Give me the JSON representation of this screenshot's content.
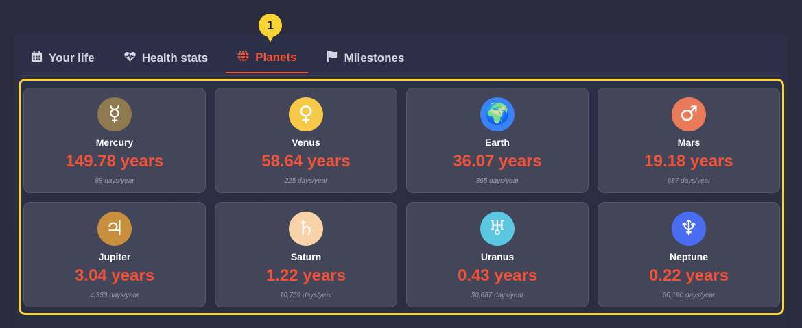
{
  "tour": {
    "step": "1",
    "color": "#f9d334"
  },
  "tabs": [
    {
      "label": "Your life",
      "icon": "calendar-icon",
      "active": false
    },
    {
      "label": "Health stats",
      "icon": "heartbeat-icon",
      "active": false
    },
    {
      "label": "Planets",
      "icon": "globe-icon",
      "active": true
    },
    {
      "label": "Milestones",
      "icon": "flag-icon",
      "active": false
    }
  ],
  "accent_color": "#f0533a",
  "planets": [
    {
      "name": "Mercury",
      "symbol": "☿",
      "age": "149.78 years",
      "days": "88 days/year",
      "color": "#8e7a4e"
    },
    {
      "name": "Venus",
      "symbol": "♀",
      "age": "58.64 years",
      "days": "225 days/year",
      "color": "#f7c948"
    },
    {
      "name": "Earth",
      "symbol": "🌍",
      "age": "36.07 years",
      "days": "365 days/year",
      "color": "#3b82f6"
    },
    {
      "name": "Mars",
      "symbol": "♂",
      "age": "19.18 years",
      "days": "687 days/year",
      "color": "#e97b5a"
    },
    {
      "name": "Jupiter",
      "symbol": "♃",
      "age": "3.04 years",
      "days": "4,333 days/year",
      "color": "#c88f3c"
    },
    {
      "name": "Saturn",
      "symbol": "♄",
      "age": "1.22 years",
      "days": "10,759 days/year",
      "color": "#f8d2a8"
    },
    {
      "name": "Uranus",
      "symbol": "♅",
      "age": "0.43 years",
      "days": "30,687 days/year",
      "color": "#5ac8e3"
    },
    {
      "name": "Neptune",
      "symbol": "♆",
      "age": "0.22 years",
      "days": "60,190 days/year",
      "color": "#4a6cf2"
    }
  ]
}
